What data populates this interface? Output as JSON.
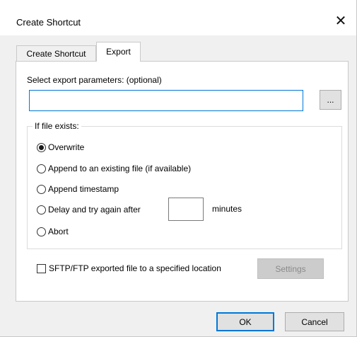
{
  "window": {
    "title": "Create Shortcut",
    "close_glyph": "✕"
  },
  "tabs": [
    {
      "label": "Create Shortcut",
      "active": false
    },
    {
      "label": "Export",
      "active": true
    }
  ],
  "export": {
    "params_label": "Select export parameters: (optional)",
    "params_value": "",
    "params_placeholder": "",
    "browse_label": "...",
    "if_exists": {
      "legend": "If file exists:",
      "options": [
        {
          "label": "Overwrite",
          "checked": true
        },
        {
          "label": "Append to an existing file (if available)",
          "checked": false
        },
        {
          "label": "Append timestamp",
          "checked": false
        },
        {
          "label": "Delay and try again after",
          "checked": false
        },
        {
          "label": "Abort",
          "checked": false
        }
      ],
      "delay_value": "",
      "minutes_label": "minutes"
    },
    "sftp": {
      "label": "SFTP/FTP exported file to a specified location",
      "checked": false,
      "settings_label": "Settings",
      "settings_enabled": false
    }
  },
  "footer": {
    "ok_label": "OK",
    "cancel_label": "Cancel"
  },
  "colors": {
    "accent": "#0078d7",
    "dialog_bg": "#f0f0f0",
    "panel_bg": "#ffffff",
    "disabled_text": "#8a8a8a"
  },
  "icons": {
    "close": "close-icon",
    "radio_checked": "radio-checked-icon",
    "radio_unchecked": "radio-unchecked-icon",
    "checkbox_unchecked": "checkbox-unchecked-icon"
  }
}
